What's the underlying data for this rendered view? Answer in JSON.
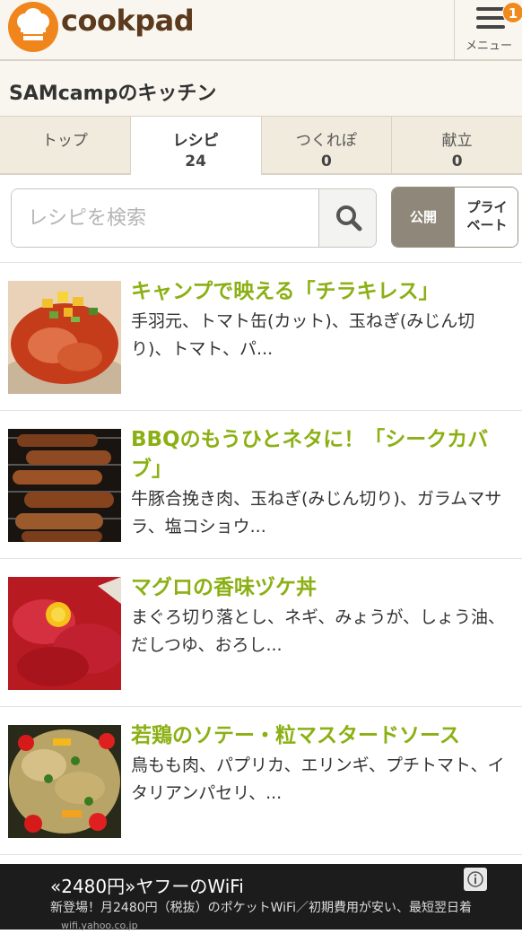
{
  "header": {
    "logo_text": "cookpad",
    "menu_label": "メニュー",
    "menu_badge": "1"
  },
  "kitchen": {
    "title": "SAMcampのキッチン"
  },
  "tabs": [
    {
      "label": "トップ",
      "count": ""
    },
    {
      "label": "レシピ",
      "count": "24"
    },
    {
      "label": "つくれぽ",
      "count": "0"
    },
    {
      "label": "献立",
      "count": "0"
    }
  ],
  "search": {
    "placeholder": "レシピを検索",
    "value": ""
  },
  "visibility_toggle": {
    "public_label": "公開",
    "private_label_line1": "プライ",
    "private_label_line2": "ベート",
    "selected": "公開"
  },
  "recipes": [
    {
      "title": "キャンプで映える「チラキレス」",
      "ingredients": "手羽元、トマト缶(カット)、玉ねぎ(みじん切り)、トマト、パ..."
    },
    {
      "title": "BBQのもうひとネタに！「シークカバブ」",
      "ingredients": "牛豚合挽き肉、玉ねぎ(みじん切り)、ガラムマサラ、塩コショウ..."
    },
    {
      "title": "マグロの香味ヅケ丼",
      "ingredients": "まぐろ切り落とし、ネギ、みょうが、しょう油、だしつゆ、おろし..."
    },
    {
      "title": "若鶏のソテー・粒マスタードソース",
      "ingredients": "鳥もも肉、パプリカ、エリンギ、プチトマト、イタリアンパセリ、..."
    }
  ],
  "ad": {
    "title": "«2480円»ヤフーのWiFi",
    "desc": "新登場！月2480円（税抜）のポケットWiFi／初期費用が安い、最短翌日着",
    "url": "wifi.yahoo.co.jp"
  },
  "colors": {
    "brand_orange": "#f0851c",
    "logo_brown": "#5b3a1d",
    "recipe_title_green": "#8bb013",
    "header_bg": "#f8f6ef"
  },
  "icons": [
    "chef-hat-icon",
    "hamburger-menu-icon",
    "search-icon",
    "ad-info-icon"
  ]
}
